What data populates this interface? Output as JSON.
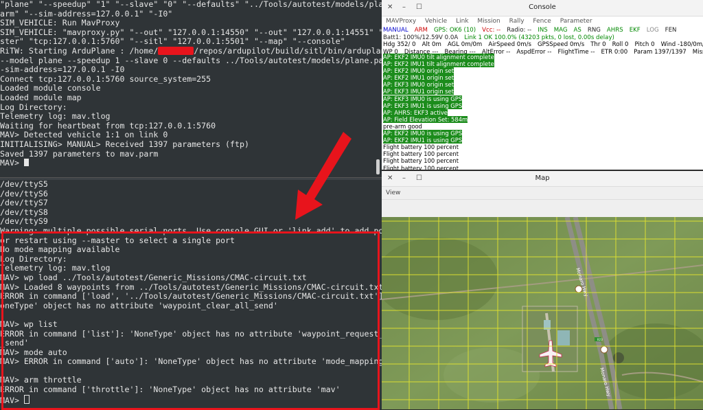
{
  "terminal_top": {
    "lines": [
      "\"plane\" \"--speedup\" \"1\" \"--slave\" \"0\" \"--defaults\" \"../Tools/autotest/models/plane.p",
      "arm\" \"--sim-address=127.0.0.1\" \"-I0\"",
      "SIM_VEHICLE: Run MavProxy",
      "SIM_VEHICLE: \"mavproxy.py\" \"--out\" \"127.0.0.1:14550\" \"--out\" \"127.0.0.1:14551\" \"--ma",
      "ster\" \"tcp:127.0.0.1:5760\" \"--sitl\" \"127.0.0.1:5501\" \"--map\" \"--console\"",
      "",
      "--model plane --speedup 1 --slave 0 --defaults ../Tools/autotest/models/plane.parm -",
      "-sim-address=127.0.0.1 -I0",
      "Connect tcp:127.0.0.1:5760 source_system=255",
      "Loaded module console",
      "Loaded module map",
      "Log Directory:",
      "Telemetry log: mav.tlog",
      "Waiting for heartbeat from tcp:127.0.0.1:5760",
      "MAV> Detected vehicle 1:1 on link 0",
      "INITIALISING> MANUAL> Received 1397 parameters (ftp)",
      "Saved 1397 parameters to mav.parm",
      "MAV> "
    ],
    "ritw_prefix": "RiTW: Starting ArduPlane : /home/",
    "ritw_suffix": "/repos/ardupilot/build/sitl/bin/arduplane -S"
  },
  "terminal_bottom": {
    "lines": [
      "/dev/ttyS5",
      "/dev/ttyS6",
      "/dev/ttyS7",
      "/dev/ttyS8",
      "/dev/ttyS9",
      "Warning: multiple possible serial ports. Use console GUI or 'link add' to add port,",
      "or restart using --master to select a single port",
      "No mode mapping available",
      "Log Directory:",
      "Telemetry log: mav.tlog",
      "MAV> wp load ../Tools/autotest/Generic_Missions/CMAC-circuit.txt",
      "MAV> Loaded 8 waypoints from ../Tools/autotest/Generic_Missions/CMAC-circuit.txt",
      "ERROR in command ['load', '../Tools/autotest/Generic_Missions/CMAC-circuit.txt']: 'N",
      "oneType' object has no attribute 'waypoint_clear_all_send'",
      "",
      "MAV> wp list",
      "ERROR in command ['list']: 'NoneType' object has no attribute 'waypoint_request_list",
      "_send'",
      "MAV> mode auto",
      "MAV> ERROR in command ['auto']: 'NoneType' object has no attribute 'mode_mapping'",
      "",
      "MAV> arm throttle",
      "ERROR in command ['throttle']: 'NoneType' object has no attribute 'mav'",
      "MAV> "
    ]
  },
  "console": {
    "title": "Console",
    "menu": [
      "MAVProxy",
      "Vehicle",
      "Link",
      "Mission",
      "Rally",
      "Fence",
      "Parameter"
    ],
    "status_row1": [
      {
        "text": "MANUAL",
        "color": "#0000cc"
      },
      {
        "text": "ARM",
        "color": "#cc0000"
      },
      {
        "text": "GPS: OK6 (10)",
        "color": "#008800"
      },
      {
        "text": "Vcc: --",
        "color": "#cc0000"
      },
      {
        "text": "Radio: --",
        "color": "#222222"
      },
      {
        "text": "INS",
        "color": "#008800"
      },
      {
        "text": "MAG",
        "color": "#008800"
      },
      {
        "text": "AS",
        "color": "#008800"
      },
      {
        "text": "RNG",
        "color": "#222222"
      },
      {
        "text": "AHRS",
        "color": "#008800"
      },
      {
        "text": "EKF",
        "color": "#008800"
      },
      {
        "text": "LOG",
        "color": "#888888"
      },
      {
        "text": "FEN",
        "color": "#222222"
      }
    ],
    "status_row2": [
      {
        "text": "Batt1: 100%/12.59V 0.0A",
        "color": "#222222"
      },
      {
        "text": "Link 1 OK 100.0% (43203 pkts, 0 lost, 0.00s delay)",
        "color": "#008800"
      }
    ],
    "status_row3": [
      "Hdg 352/ 0",
      "Alt 0m",
      "AGL 0m/0m",
      "AirSpeed 0m/s",
      "GPSSpeed 0m/s",
      "Thr 0",
      "Roll 0",
      "Pitch 0",
      "Wind -180/0m/s"
    ],
    "status_row4": [
      "WP 0",
      "Distance ---",
      "Bearing ---",
      "AltError --",
      "AspdError --",
      "FlightTime --",
      "ETR 0:00",
      "Param 1397/1397",
      "Mission"
    ],
    "messages": [
      {
        "text": "AP: EKF2 IMU0 tilt alignment complete",
        "hl": true
      },
      {
        "text": "AP: EKF2 IMU1 tilt alignment complete",
        "hl": true
      },
      {
        "text": "AP: EKF2 IMU0 origin set",
        "hl": true
      },
      {
        "text": "AP: EKF2 IMU1 origin set",
        "hl": true
      },
      {
        "text": "AP: EKF3 IMU0 origin set",
        "hl": true
      },
      {
        "text": "AP: EKF3 IMU1 origin set",
        "hl": true
      },
      {
        "text": "AP: EKF3 IMU0 is using GPS",
        "hl": true
      },
      {
        "text": "AP: EKF3 IMU1 is using GPS",
        "hl": true
      },
      {
        "text": "AP: AHRS: EKF3 active",
        "hl": true
      },
      {
        "text": "AP: Field Elevation Set: 584m",
        "hl": true
      },
      {
        "text": "pre-arm good",
        "hl": false
      },
      {
        "text": "AP: EKF2 IMU0 is using GPS",
        "hl": true
      },
      {
        "text": "AP: EKF2 IMU1 is using GPS",
        "hl": true
      },
      {
        "text": "Flight battery 100 percent",
        "hl": false
      },
      {
        "text": "Flight battery 100 percent",
        "hl": false
      },
      {
        "text": "Flight battery 100 percent",
        "hl": false
      },
      {
        "text": "Flight battery 100 percent",
        "hl": false
      }
    ]
  },
  "map": {
    "title": "Map",
    "view_menu": "View",
    "road_label_1": "Monaro Hwy",
    "road_label_2": "Monaro Hwy",
    "road_badge": "B23"
  },
  "colors": {
    "terminal_bg": "#2f3437",
    "highlight_box": "#e8141c",
    "map_grid": "#e6e62e",
    "msg_highlight": "#1c8c1c"
  }
}
